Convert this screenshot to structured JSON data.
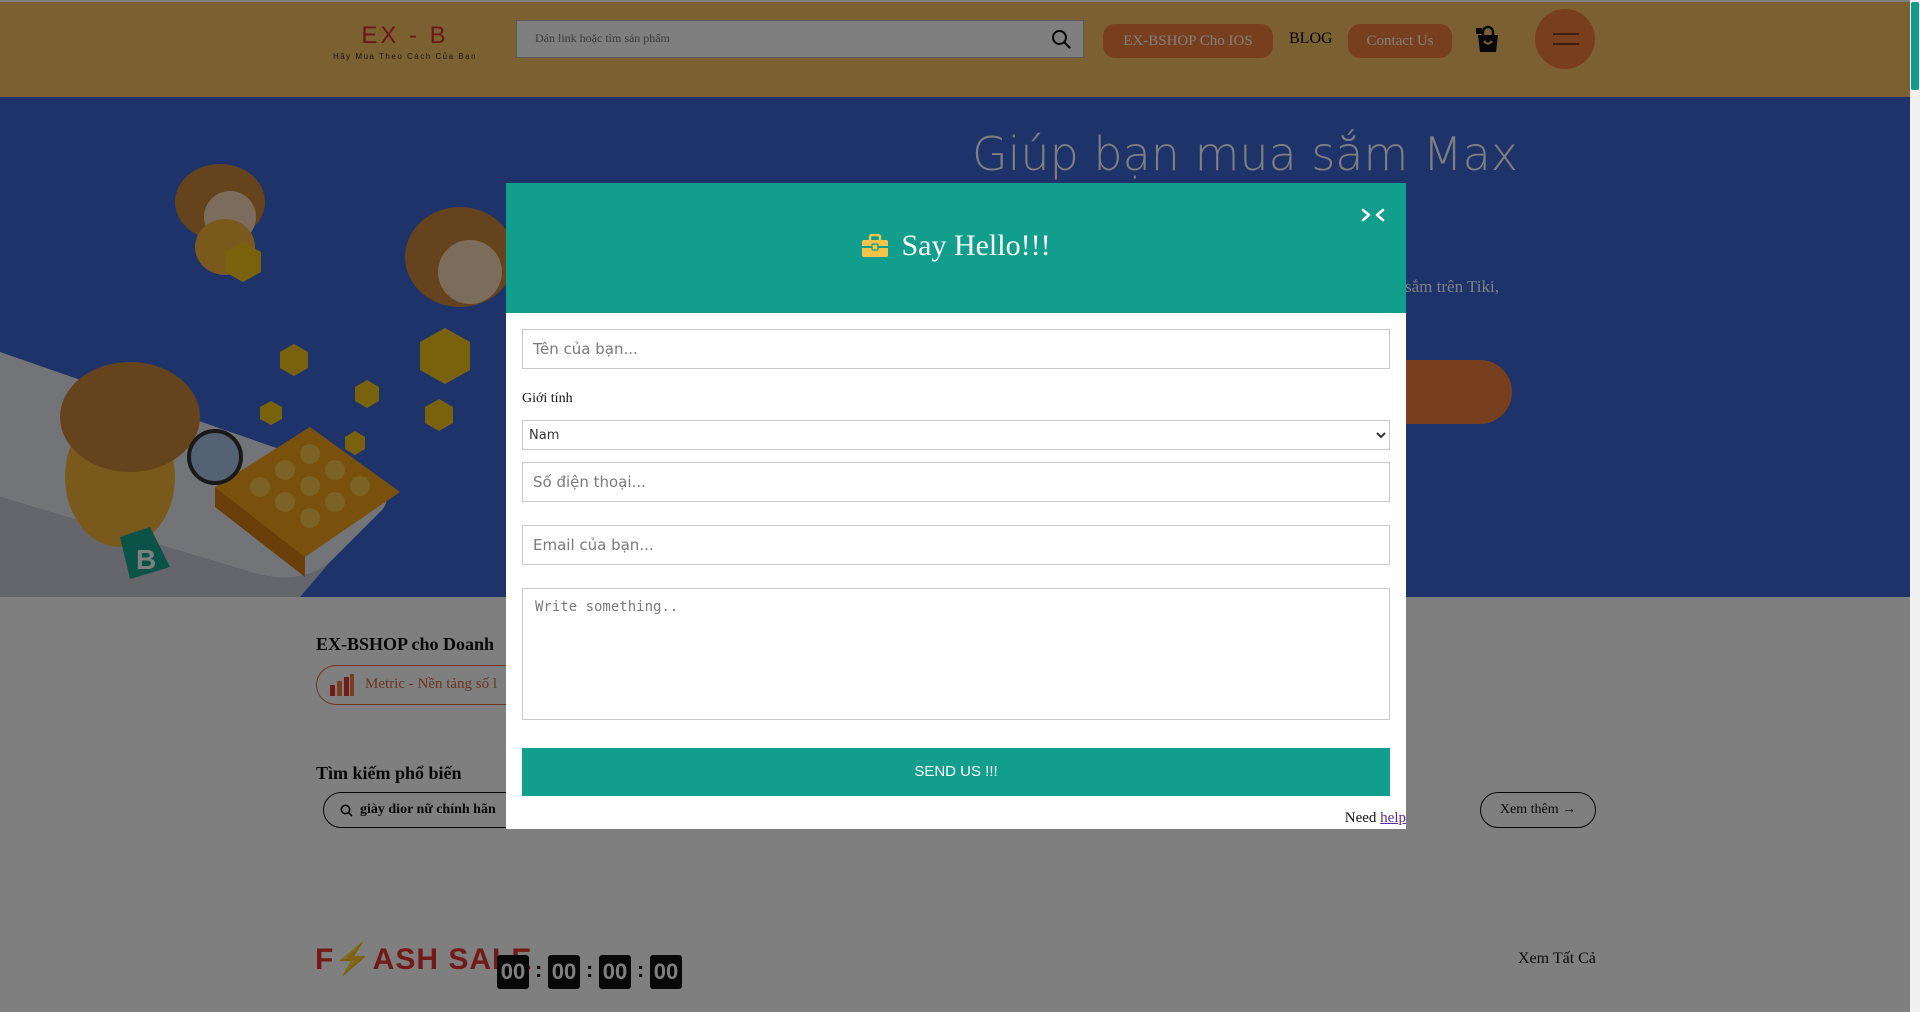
{
  "header": {
    "logo_title": "EX - B",
    "logo_tagline": "Hãy Mua Theo Cách Của Bạn",
    "search_placeholder": "Dán link hoặc tìm sản phẩm",
    "ios_button": "EX-BSHOP Cho IOS",
    "blog_link": "BLOG",
    "contact_button": "Contact Us"
  },
  "hero": {
    "title": "Giúp bạn mua sắm Max",
    "subtitle_fragment": "sắm trên Tiki,"
  },
  "business": {
    "title": "EX-BSHOP cho Doanh",
    "metric_label": "Metric - Nền tảng số l"
  },
  "popular": {
    "title": "Tìm kiếm phổ biến",
    "chip_label": "giày dior nữ chính hãn",
    "more_label": "Xem thêm →"
  },
  "flash_sale": {
    "logo_text": "F⚡ASH SALE",
    "timer": [
      "00",
      "00",
      "00",
      "00"
    ],
    "view_all": "Xem Tất Cả"
  },
  "modal": {
    "title": "Say Hello!!!",
    "name_placeholder": "Tên của bạn...",
    "gender_label": "Giới tính",
    "gender_selected": "Nam",
    "phone_placeholder": "Số điện thoại...",
    "email_placeholder": "Email của bạn...",
    "message_placeholder": "Write something..",
    "send_label": "SEND US !!!",
    "help_prefix": "Need ",
    "help_link": "help"
  },
  "colors": {
    "header_bg": "#f7c065",
    "hero_bg": "#3d67d2",
    "accent_orange": "#f07f3e",
    "modal_teal": "#119e8c",
    "flash_red": "#e3342f"
  },
  "icons": [
    "search-icon",
    "shopping-bag-icon",
    "hamburger-menu-icon",
    "close-icon",
    "briefcase-icon",
    "bar-chart-icon",
    "arrow-right-icon"
  ]
}
